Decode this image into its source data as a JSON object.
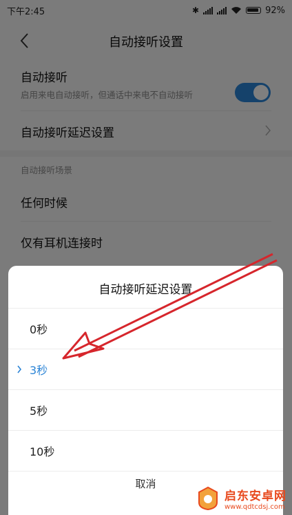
{
  "status_bar": {
    "time": "下午2:45",
    "battery": "92%"
  },
  "header": {
    "title": "自动接听设置"
  },
  "settings": {
    "auto_answer": {
      "label": "自动接听",
      "description": "启用来电自动接听，但通话中来电不自动接听",
      "enabled": true
    },
    "delay": {
      "label": "自动接听延迟设置"
    },
    "scene_section": "自动接听场景",
    "scenes": [
      "任何时候",
      "仅有耳机连接时"
    ]
  },
  "dialog": {
    "title": "自动接听延迟设置",
    "options": [
      "0秒",
      "3秒",
      "5秒",
      "10秒"
    ],
    "selected": "3秒",
    "cancel": "取消"
  },
  "watermark": {
    "name": "启东安卓网",
    "url": "www.qdtcdsj.com"
  },
  "colors": {
    "accent": "#2b84d6",
    "annotation_arrow": "#d6262c",
    "watermark": "#e8491d"
  }
}
